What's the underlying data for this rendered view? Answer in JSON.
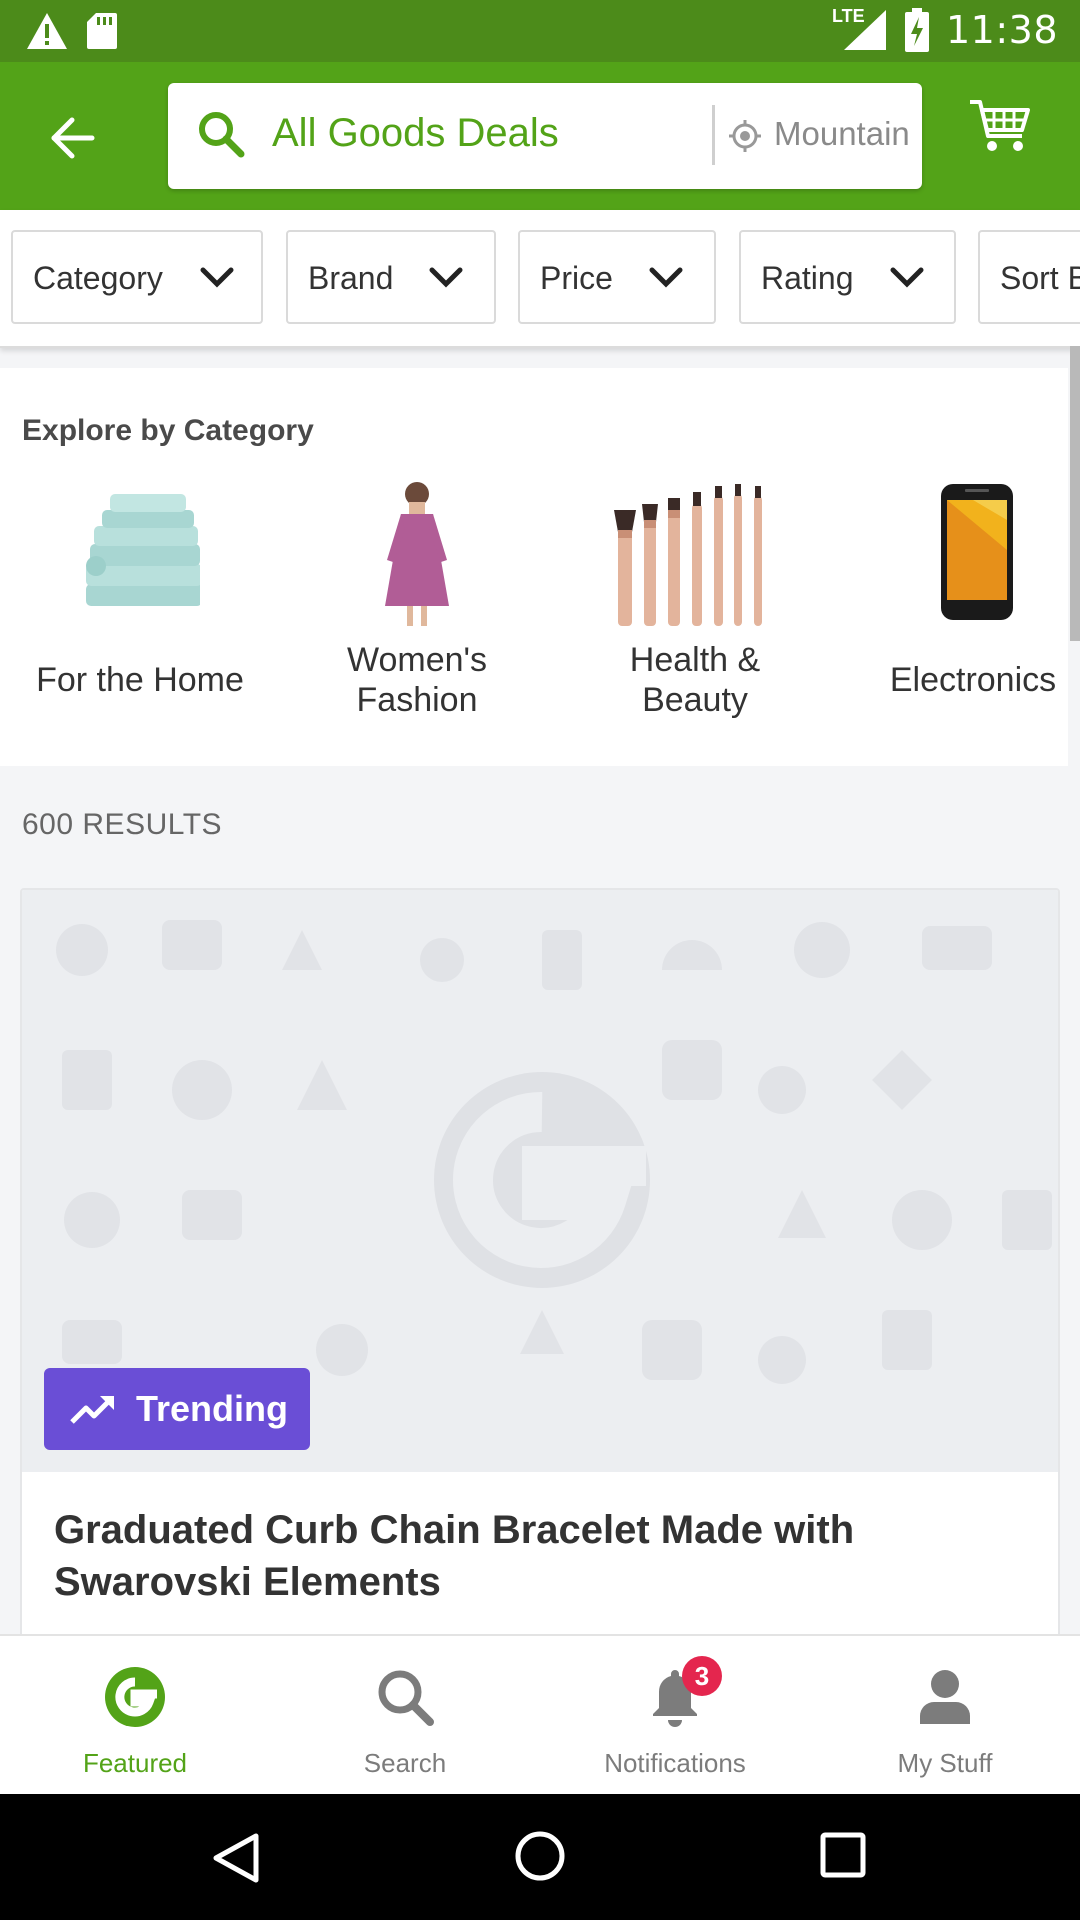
{
  "status_bar": {
    "time": "11:38",
    "network": "LTE",
    "icons": [
      "warning-icon",
      "sd-card-icon",
      "signal-icon",
      "battery-charging-icon"
    ]
  },
  "app_bar": {
    "search_query": "All Goods Deals",
    "location": "Mountain View",
    "icons": [
      "back-arrow-icon",
      "search-icon",
      "location-icon",
      "cart-icon"
    ]
  },
  "filters": [
    {
      "label": "Category"
    },
    {
      "label": "Brand"
    },
    {
      "label": "Price"
    },
    {
      "label": "Rating"
    },
    {
      "label": "Sort By"
    }
  ],
  "explore": {
    "title": "Explore by Category",
    "items": [
      {
        "line1": "For the Home",
        "line2": ""
      },
      {
        "line1": "Women's",
        "line2": "Fashion"
      },
      {
        "line1": "Health &",
        "line2": "Beauty"
      },
      {
        "line1": "Electronics",
        "line2": ""
      }
    ]
  },
  "results_count": "600 RESULTS",
  "product_card": {
    "badge": "Trending",
    "title": "Graduated Curb Chain Bracelet Made with Swarovski Elements"
  },
  "bottom_nav": {
    "items": [
      {
        "label": "Featured",
        "active": true
      },
      {
        "label": "Search",
        "active": false
      },
      {
        "label": "Notifications",
        "active": false
      },
      {
        "label": "My Stuff",
        "active": false
      }
    ],
    "notification_badge": "3"
  },
  "colors": {
    "brand_green": "#53a318",
    "status_green": "#4c8b1a",
    "trending_purple": "#6a4ed6",
    "badge_red": "#e4264e"
  }
}
